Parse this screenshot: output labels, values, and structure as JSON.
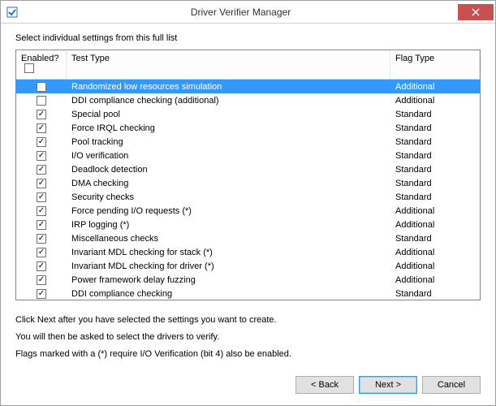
{
  "title": "Driver Verifier Manager",
  "instruction": "Select individual settings from this full list",
  "columns": {
    "enabled": "Enabled?",
    "test": "Test Type",
    "flag": "Flag Type"
  },
  "rows": [
    {
      "checked": false,
      "selected": true,
      "test": "Randomized low resources simulation",
      "flag": "Additional"
    },
    {
      "checked": false,
      "selected": false,
      "test": "DDI compliance checking (additional)",
      "flag": "Additional"
    },
    {
      "checked": true,
      "selected": false,
      "test": "Special pool",
      "flag": "Standard"
    },
    {
      "checked": true,
      "selected": false,
      "test": "Force IRQL checking",
      "flag": "Standard"
    },
    {
      "checked": true,
      "selected": false,
      "test": "Pool tracking",
      "flag": "Standard"
    },
    {
      "checked": true,
      "selected": false,
      "test": "I/O verification",
      "flag": "Standard"
    },
    {
      "checked": true,
      "selected": false,
      "test": "Deadlock detection",
      "flag": "Standard"
    },
    {
      "checked": true,
      "selected": false,
      "test": "DMA checking",
      "flag": "Standard"
    },
    {
      "checked": true,
      "selected": false,
      "test": "Security checks",
      "flag": "Standard"
    },
    {
      "checked": true,
      "selected": false,
      "test": "Force pending I/O requests (*)",
      "flag": "Additional"
    },
    {
      "checked": true,
      "selected": false,
      "test": "IRP logging (*)",
      "flag": "Additional"
    },
    {
      "checked": true,
      "selected": false,
      "test": "Miscellaneous checks",
      "flag": "Standard"
    },
    {
      "checked": true,
      "selected": false,
      "test": "Invariant MDL checking for stack (*)",
      "flag": "Additional"
    },
    {
      "checked": true,
      "selected": false,
      "test": "Invariant MDL checking for driver (*)",
      "flag": "Additional"
    },
    {
      "checked": true,
      "selected": false,
      "test": "Power framework delay fuzzing",
      "flag": "Additional"
    },
    {
      "checked": true,
      "selected": false,
      "test": "DDI compliance checking",
      "flag": "Standard"
    }
  ],
  "notes": {
    "line1": "Click Next after you have selected the settings you want to create.",
    "line2": "You will then be asked to select the drivers to verify.",
    "line3": "Flags marked with a (*) require I/O Verification (bit 4) also be enabled."
  },
  "buttons": {
    "back": "< Back",
    "next": "Next >",
    "cancel": "Cancel"
  }
}
